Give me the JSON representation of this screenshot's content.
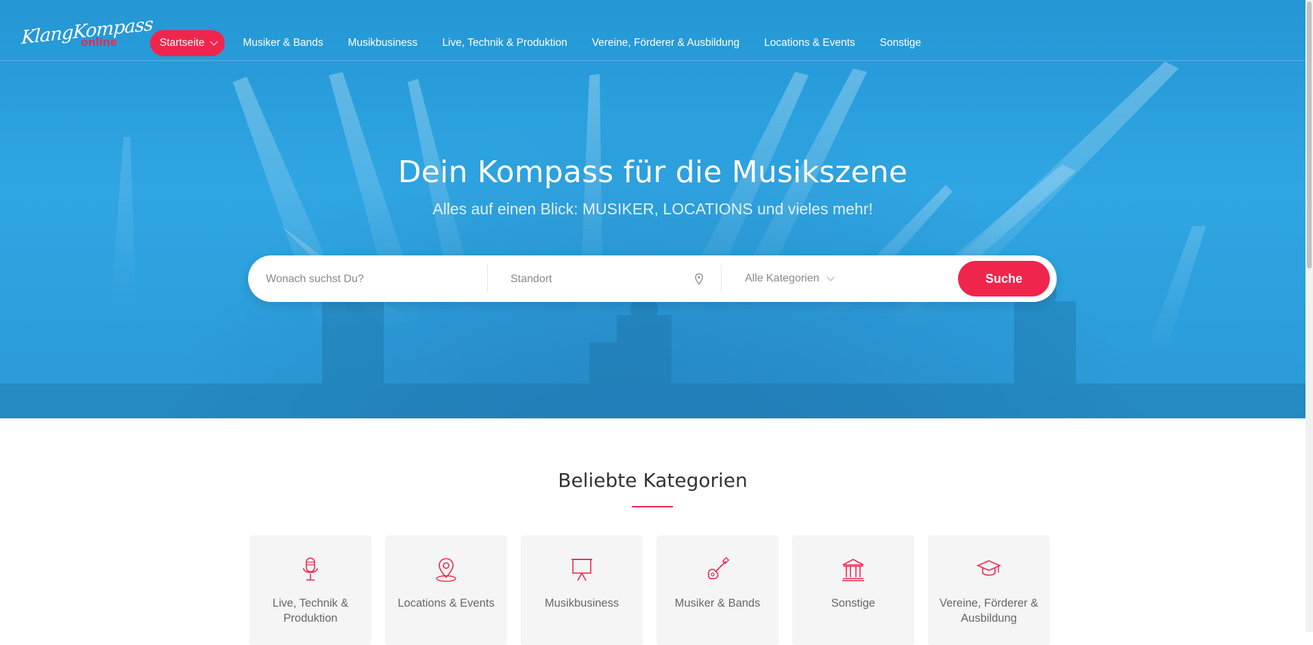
{
  "brand": {
    "logo_text": "KlangKompass",
    "logo_sub": "online",
    "accent_color": "#f0254d",
    "hero_color": "#2fa6e3"
  },
  "nav": {
    "items": [
      {
        "label": "Startseite",
        "active": true
      },
      {
        "label": "Musiker & Bands"
      },
      {
        "label": "Musikbusiness"
      },
      {
        "label": "Live, Technik & Produktion"
      },
      {
        "label": "Vereine, Förderer & Ausbildung"
      },
      {
        "label": "Locations & Events"
      },
      {
        "label": "Sonstige"
      }
    ]
  },
  "hero": {
    "title": "Dein Kompass für die Musikszene",
    "subtitle": "Alles auf einen Blick: MUSIKER, LOCATIONS und vieles mehr!"
  },
  "search": {
    "what_placeholder": "Wonach suchst Du?",
    "where_placeholder": "Standort",
    "category_value": "Alle Kategorien",
    "button_label": "Suche"
  },
  "categories": {
    "title": "Beliebte Kategorien",
    "items": [
      {
        "label": "Live, Technik & Produktion",
        "icon": "microphone-icon"
      },
      {
        "label": "Locations & Events",
        "icon": "map-pin-icon"
      },
      {
        "label": "Musikbusiness",
        "icon": "presentation-board-icon"
      },
      {
        "label": "Musiker & Bands",
        "icon": "guitar-icon"
      },
      {
        "label": "Sonstige",
        "icon": "building-icon"
      },
      {
        "label": "Vereine, Förderer & Ausbildung",
        "icon": "graduation-cap-icon"
      }
    ]
  }
}
